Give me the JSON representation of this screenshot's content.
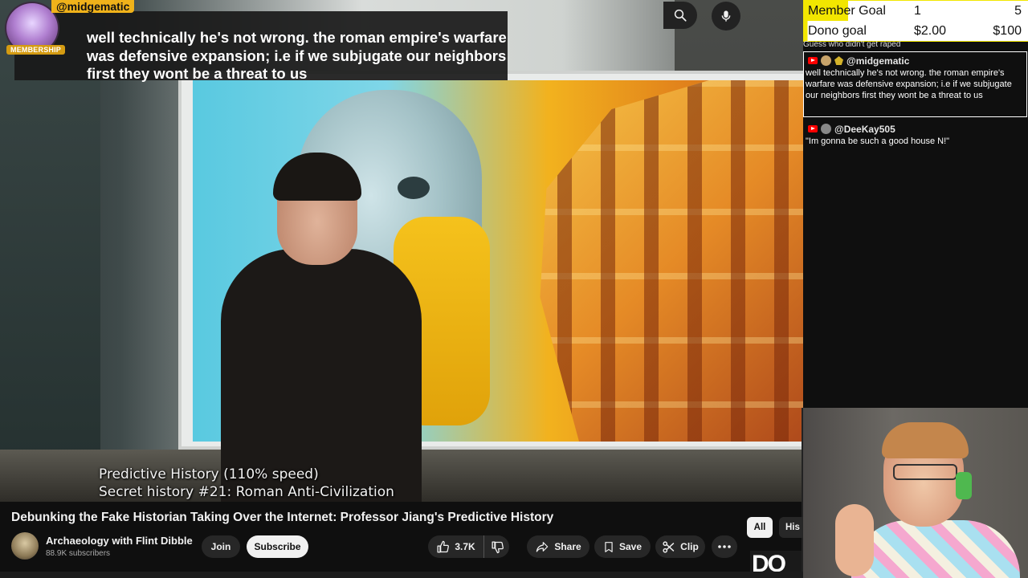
{
  "highlight": {
    "username": "@midgematic",
    "badge": "MEMBERSHIP",
    "message": "well technically he's not wrong. the roman empire's warfare was defensive expansion; i.e if we subjugate our neighbors first they wont be a threat to us"
  },
  "goals": {
    "member": {
      "label": "Member Goal",
      "current": "1",
      "target": "5",
      "progress_fraction": 0.2
    },
    "dono": {
      "label": "Dono goal",
      "current": "$2.00",
      "target": "$100",
      "progress_fraction": 0.02
    }
  },
  "chat": {
    "truncated_line": "Guess who didn't get raped",
    "messages": [
      {
        "user": "@midgematic",
        "text": "well technically he's not wrong. the roman empire's warfare was defensive expansion; i.e if we subjugate our neighbors first they wont be a threat to us"
      },
      {
        "user": "@DeeKay505",
        "text": "\"Im gonna be such a good house N!\""
      }
    ]
  },
  "video": {
    "caption_line1": "Predictive History (110% speed)",
    "caption_line2": "Secret history #21: Roman Anti-Civilization",
    "title": "Debunking the Fake Historian Taking Over the Internet: Professor Jiang's Predictive History"
  },
  "channel": {
    "name": "Archaeology with Flint Dibble",
    "subscribers": "88.9K subscribers"
  },
  "actions": {
    "join": "Join",
    "subscribe": "Subscribe",
    "likes": "3.7K",
    "share": "Share",
    "save": "Save",
    "clip": "Clip"
  },
  "chips": {
    "all": "All",
    "his": "His"
  },
  "thumb_peek": "DO",
  "icons": {
    "search": "search-icon",
    "mic": "mic-icon",
    "like": "thumbs-up-icon",
    "dislike": "thumbs-down-icon",
    "share": "share-arrow-icon",
    "save": "bookmark-icon",
    "clip": "scissors-icon",
    "more": "more-horizontal-icon"
  },
  "colors": {
    "goal_fill": "#f2e600",
    "membership_badge": "#d49b12",
    "subscribe_bg": "#f1f1f1",
    "page_bg": "#0f0f0f"
  }
}
